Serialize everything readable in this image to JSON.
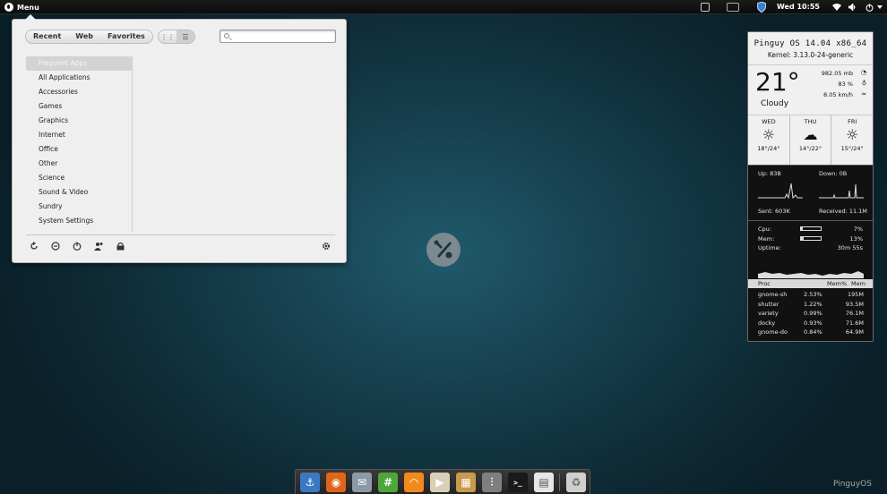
{
  "topbar": {
    "menu_label": "Menu",
    "clock": "Wed 10:55",
    "tray_icons": [
      "screen-icon",
      "display-icon",
      "shield-icon",
      "wifi-icon",
      "volume-icon",
      "power-icon"
    ]
  },
  "menu": {
    "tabs": [
      "Recent",
      "Web",
      "Favorites"
    ],
    "view_grid_glyph": "⋮⋮",
    "view_list_glyph": "☰",
    "search_placeholder": "",
    "categories": [
      "Frequent Apps",
      "All Applications",
      "Accessories",
      "Games",
      "Graphics",
      "Internet",
      "Office",
      "Other",
      "Science",
      "Sound & Video",
      "Sundry",
      "System Settings"
    ],
    "selected_category": "Frequent Apps",
    "bottom_icons": [
      "refresh-icon",
      "minus-circle-icon",
      "power-icon",
      "users-icon",
      "lock-icon",
      "settings-icon"
    ]
  },
  "conky": {
    "title": "Pinguy OS 14.04 x86_64",
    "kernel": "Kernel: 3.13.0-24-generic",
    "temperature": "21°",
    "condition": "Cloudy",
    "pressure": "982.05 mb",
    "humidity": "83 %",
    "wind": "8.05 km/h",
    "forecast": [
      {
        "day": "WED",
        "icon": "☼",
        "temp": "18°/24°"
      },
      {
        "day": "THU",
        "icon": "☁",
        "temp": "14°/22°"
      },
      {
        "day": "FRI",
        "icon": "☼",
        "temp": "15°/24°"
      }
    ],
    "up": "Up: 83B",
    "down": "Down: 0B",
    "sent": "Sent: 603K",
    "received": "Received: 11.1M",
    "cpu_label": "Cpu:",
    "cpu_value": "7%",
    "cpu_fraction": 0.07,
    "mem_label": "Mem:",
    "mem_value": "13%",
    "mem_fraction": 0.13,
    "uptime_label": "Uptime:",
    "uptime_value": "30m 55s",
    "proc_headers": [
      "Proc",
      "Mem%",
      "Mem"
    ],
    "processes": [
      {
        "name": "gnome-sh",
        "pct": "2.53%",
        "mem": "195M"
      },
      {
        "name": "shutter",
        "pct": "1.22%",
        "mem": "93.5M"
      },
      {
        "name": "variety",
        "pct": "0.99%",
        "mem": "76.1M"
      },
      {
        "name": "docky",
        "pct": "0.93%",
        "mem": "71.6M"
      },
      {
        "name": "gnome-do",
        "pct": "0.84%",
        "mem": "64.9M"
      }
    ]
  },
  "dock": {
    "items": [
      {
        "name": "anchor-icon",
        "glyph": "⚓",
        "color": "#3a78c4"
      },
      {
        "name": "firefox-icon",
        "glyph": "◉",
        "color": "#e0651a"
      },
      {
        "name": "mail-icon",
        "glyph": "✉",
        "color": "#8c9aa6"
      },
      {
        "name": "hashtag-icon",
        "glyph": "#",
        "color": "#4ca63a"
      },
      {
        "name": "feed-icon",
        "glyph": "◠",
        "color": "#f08a1c"
      },
      {
        "name": "video-editor-icon",
        "glyph": "▶",
        "color": "#d9d0b8"
      },
      {
        "name": "archive-icon",
        "glyph": "▦",
        "color": "#c89a4e"
      },
      {
        "name": "mixer-icon",
        "glyph": "⫶",
        "color": "#7f7f7f"
      },
      {
        "name": "terminal-icon",
        "glyph": ">_",
        "color": "#1a1a1a"
      },
      {
        "name": "files-icon",
        "glyph": "▤",
        "color": "#e6e6e6"
      },
      {
        "name": "trash-icon",
        "glyph": "♻",
        "color": "#cfcfcf"
      }
    ]
  },
  "watermark": "PinguyOS"
}
